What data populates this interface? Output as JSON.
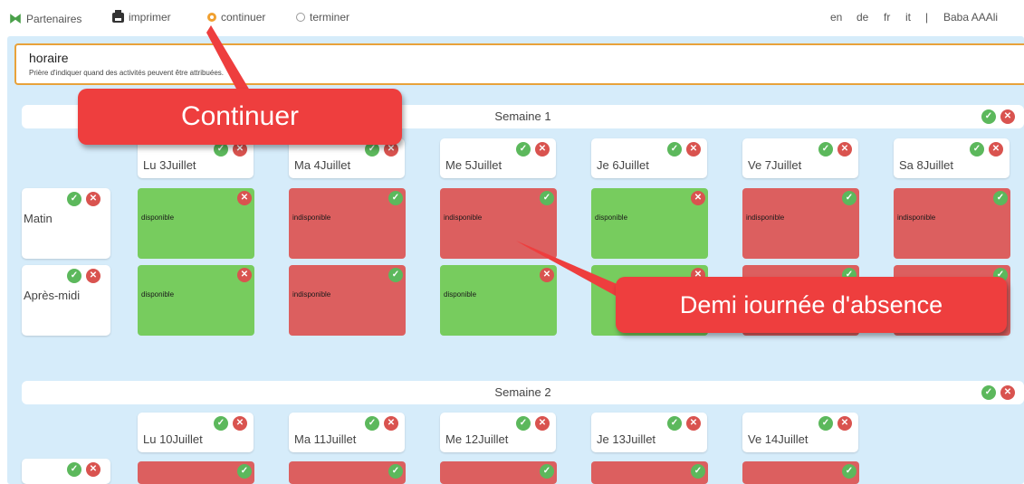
{
  "nav": {
    "partenaires": "Partenaires",
    "imprimer": "imprimer",
    "continuer": "continuer",
    "terminer": "terminer"
  },
  "langs": [
    "en",
    "de",
    "fr",
    "it"
  ],
  "separator": "|",
  "user": "Baba AAAli",
  "horaire": {
    "title": "horaire",
    "subtitle": "Prière d'indiquer quand des activités peuvent être attribuées."
  },
  "week1": {
    "label": "Semaine 1",
    "days": [
      "Lu 3Juillet",
      "Ma 4Juillet",
      "Me 5Juillet",
      "Je 6Juillet",
      "Ve 7Juillet",
      "Sa 8Juillet"
    ],
    "rows": [
      {
        "label": "Matin",
        "cells": [
          "disponible",
          "indisponible",
          "indisponible",
          "disponible",
          "indisponible",
          "indisponible"
        ]
      },
      {
        "label": "Après-midi",
        "cells": [
          "disponible",
          "indisponible",
          "disponible",
          "",
          "",
          ""
        ]
      }
    ]
  },
  "week2": {
    "label": "Semaine 2",
    "days": [
      "Lu 10Juillet",
      "Ma 11Juillet",
      "Me 12Juillet",
      "Je 13Juillet",
      "Ve 14Juillet"
    ]
  },
  "annotations": {
    "continuer": "Continuer",
    "demi_journee": "Demi iournée d'absence"
  },
  "icons": {
    "ok": "check-circle-icon",
    "ko": "x-circle-icon"
  },
  "colors": {
    "available": "#77cc5e",
    "unavailable": "#dc5f5f",
    "panel_bg": "#d6ecfa",
    "callout": "#ee3e3e"
  }
}
